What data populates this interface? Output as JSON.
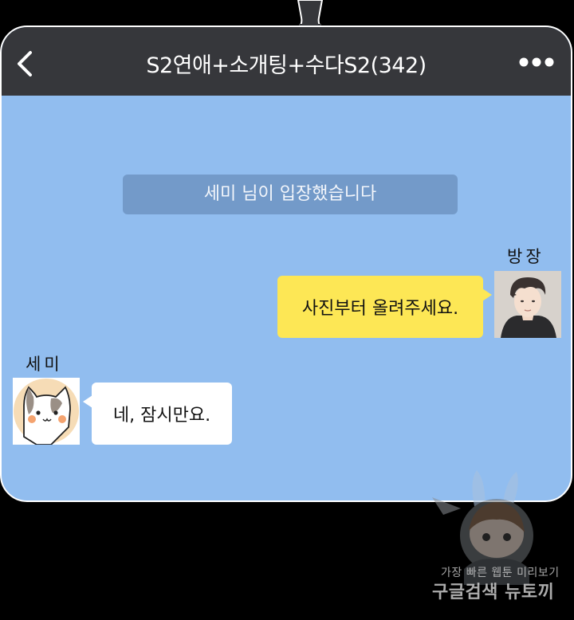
{
  "chat": {
    "title": "S2연애+소개팅+수다S2(342)",
    "back_icon": "chevron-left-icon",
    "more_icon": "more-horizontal-icon",
    "system_message": "세미 님이 입장했습니다"
  },
  "messages": [
    {
      "sender": "방장",
      "text": "사진부터 올려주세요.",
      "side": "outgoing",
      "bubble_color": "#fde755"
    },
    {
      "sender": "세미",
      "text": "네, 잠시만요.",
      "side": "incoming",
      "bubble_color": "#ffffff"
    }
  ],
  "colors": {
    "chat_background": "#91bdef",
    "header_background": "#36373b",
    "system_message_background": "#739ac9"
  },
  "watermark": {
    "line1": "가장 빠른 웹툰 미리보기",
    "line2": "구글검색 뉴토끼"
  }
}
